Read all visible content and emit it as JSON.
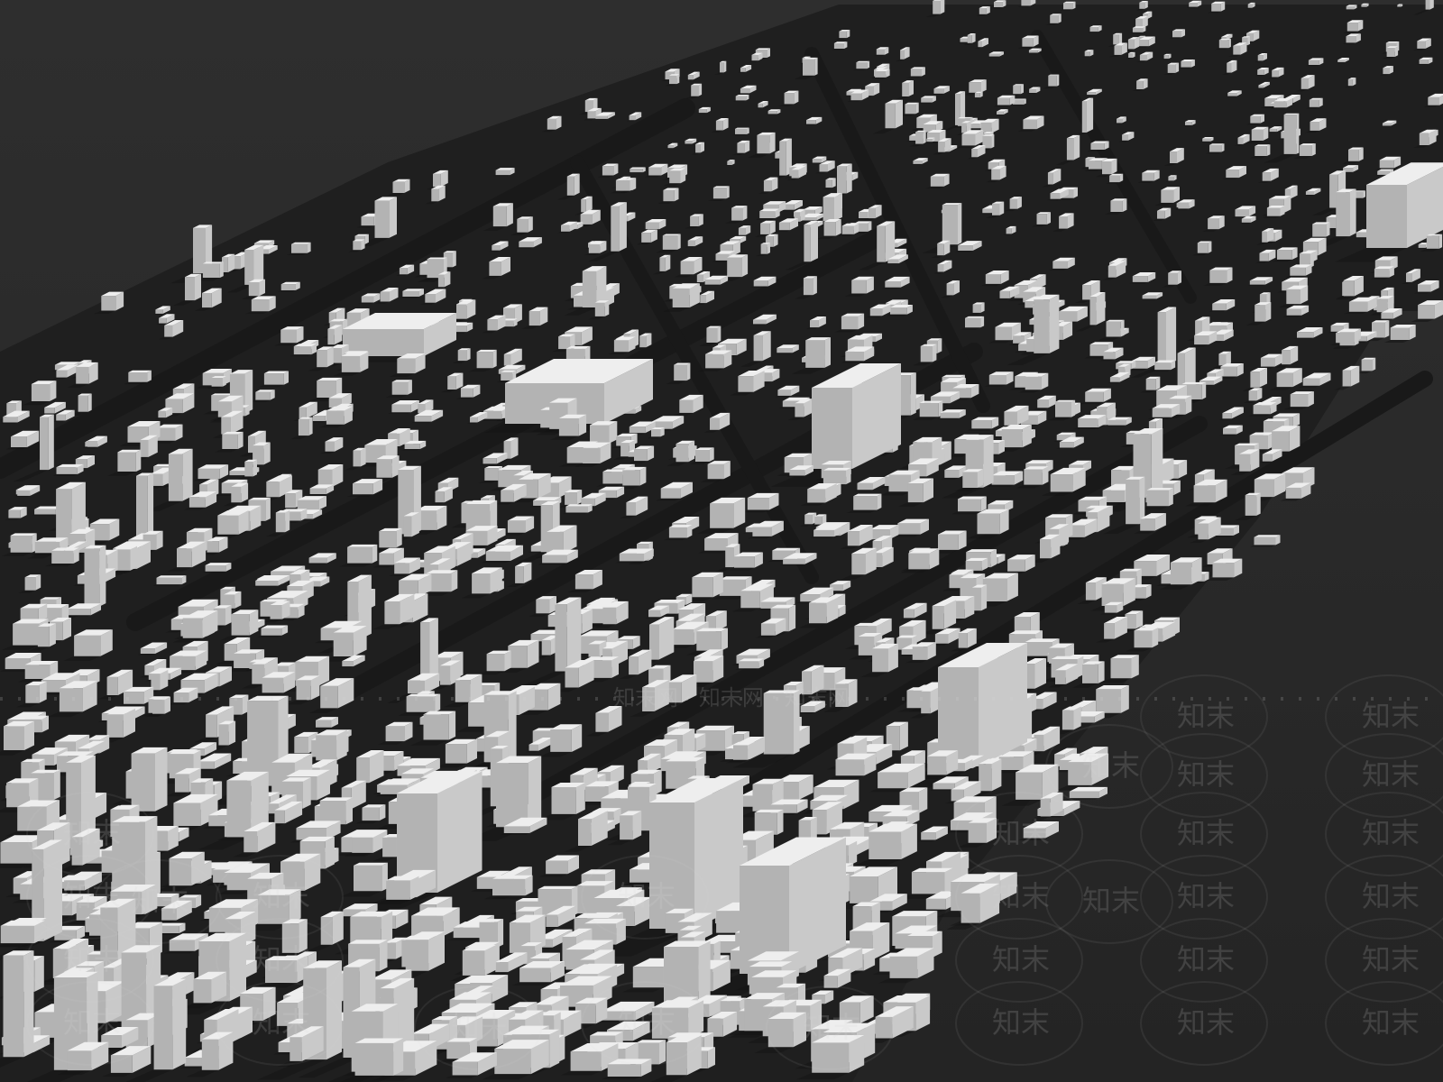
{
  "image": {
    "subject": "3d-city-massing-model",
    "background_color": "#2a2a2a",
    "ground_color": "#1d1d1d",
    "building_color": "#eeeeee",
    "building_side_color": "#c9c9c9",
    "building_shadow_color": "#b3b3b3"
  },
  "watermark": {
    "text": "知末",
    "color": "#d9d9d9",
    "banner_text": "知末网 · 知末网 · 知末网"
  }
}
